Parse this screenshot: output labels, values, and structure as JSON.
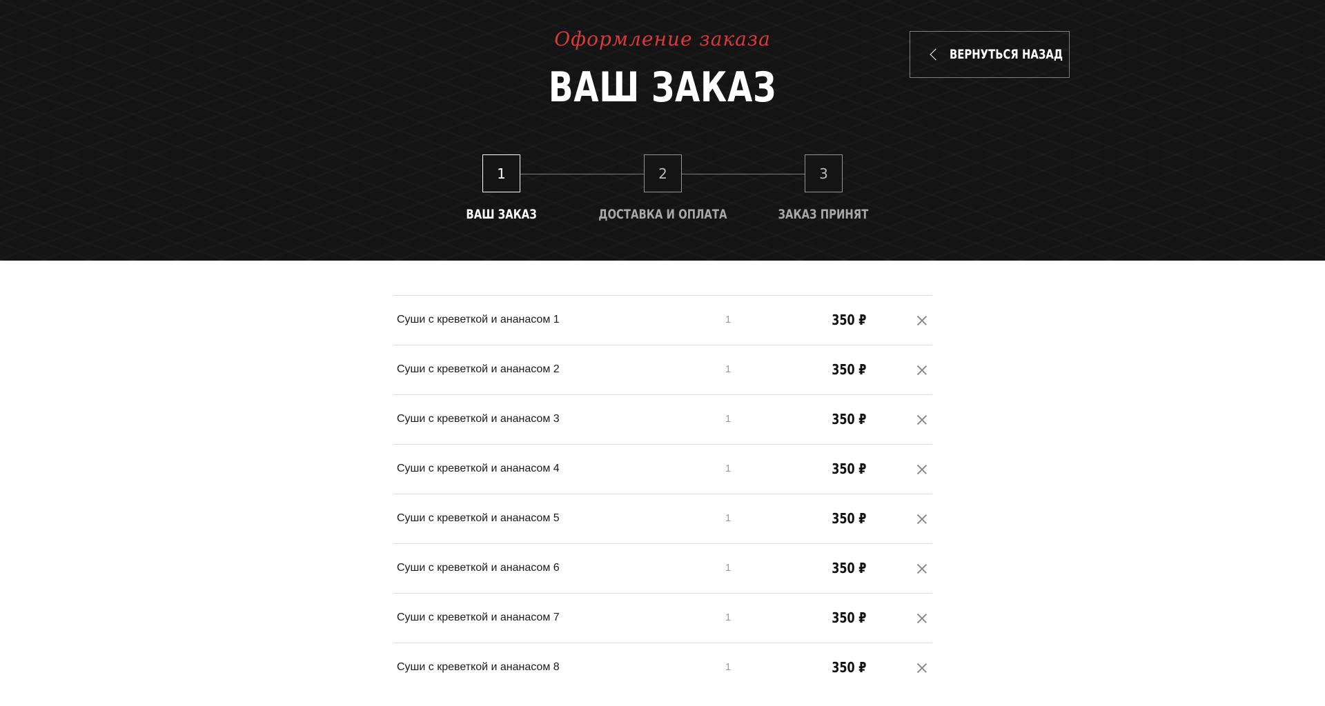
{
  "header": {
    "subtitle": "Оформление заказа",
    "title": "ВАШ ЗАКАЗ",
    "back_button_label": "ВЕРНУТЬСЯ НАЗАД"
  },
  "steps": [
    {
      "number": "1",
      "label": "ВАШ ЗАКАЗ",
      "active": true
    },
    {
      "number": "2",
      "label": "ДОСТАВКА И ОПЛАТА",
      "active": false
    },
    {
      "number": "3",
      "label": "ЗАКАЗ ПРИНЯТ",
      "active": false
    }
  ],
  "cart": {
    "items": [
      {
        "name": "Суши с креветкой и ананасом 1",
        "qty": "1",
        "price": "350 ₽"
      },
      {
        "name": "Суши с креветкой и ананасом 2",
        "qty": "1",
        "price": "350 ₽"
      },
      {
        "name": "Суши с креветкой и ананасом 3",
        "qty": "1",
        "price": "350 ₽"
      },
      {
        "name": "Суши с креветкой и ананасом 4",
        "qty": "1",
        "price": "350 ₽"
      },
      {
        "name": "Суши с креветкой и ананасом 5",
        "qty": "1",
        "price": "350 ₽"
      },
      {
        "name": "Суши с креветкой и ананасом 6",
        "qty": "1",
        "price": "350 ₽"
      },
      {
        "name": "Суши с креветкой и ананасом 7",
        "qty": "1",
        "price": "350 ₽"
      },
      {
        "name": "Суши с креветкой и ананасом 8",
        "qty": "1",
        "price": "350 ₽"
      }
    ]
  },
  "icons": {
    "back": "chevron-left-icon",
    "remove": "close-icon"
  },
  "colors": {
    "accent": "#d83a3a",
    "hero_background": "#141414"
  }
}
